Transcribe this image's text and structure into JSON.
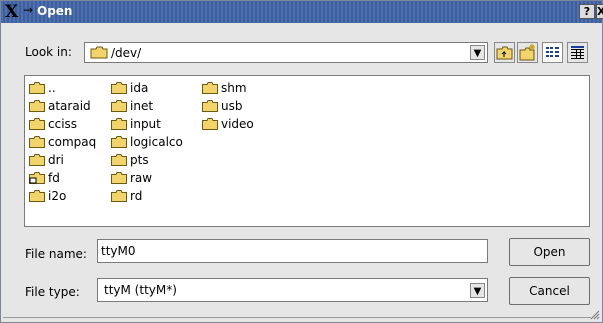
{
  "window": {
    "title": "Open",
    "arrow_glyph": "→"
  },
  "titlebar_buttons": {
    "help": "?",
    "close": "X"
  },
  "lookin": {
    "label": "Look in:",
    "path": "/dev/"
  },
  "files": [
    {
      "name": "..",
      "type": "folder"
    },
    {
      "name": "ataraid",
      "type": "folder"
    },
    {
      "name": "cciss",
      "type": "folder"
    },
    {
      "name": "compaq",
      "type": "folder"
    },
    {
      "name": "dri",
      "type": "folder"
    },
    {
      "name": "fd",
      "type": "folder-link"
    },
    {
      "name": "i2o",
      "type": "folder"
    },
    {
      "name": "ida",
      "type": "folder"
    },
    {
      "name": "inet",
      "type": "folder"
    },
    {
      "name": "input",
      "type": "folder"
    },
    {
      "name": "logicalco",
      "type": "folder"
    },
    {
      "name": "pts",
      "type": "folder"
    },
    {
      "name": "raw",
      "type": "folder"
    },
    {
      "name": "rd",
      "type": "folder"
    },
    {
      "name": "shm",
      "type": "folder"
    },
    {
      "name": "usb",
      "type": "folder"
    },
    {
      "name": "video",
      "type": "folder"
    }
  ],
  "filename": {
    "label": "File name:",
    "value": "ttyM0"
  },
  "filetype": {
    "label": "File type:",
    "value": "ttyM (ttyM*)"
  },
  "buttons": {
    "open": "Open",
    "cancel": "Cancel"
  },
  "colors": {
    "titlebar": "#3b5fa0",
    "folder": "#f2d46b"
  }
}
